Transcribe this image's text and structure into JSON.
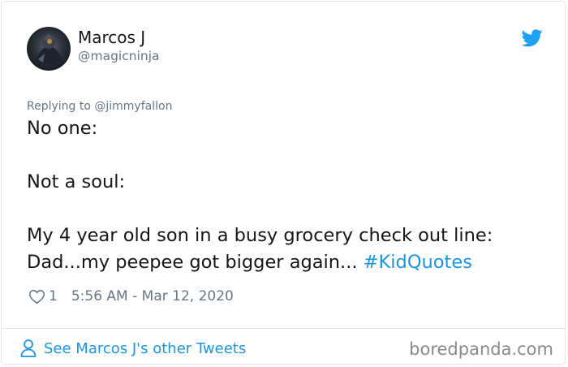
{
  "author": {
    "display_name": "Marcos J",
    "handle": "@magicninja",
    "avatar_icon": "avatar-photo"
  },
  "platform_icon": "twitter-bird-icon",
  "reply": {
    "label": "Replying to @jimmyfallon"
  },
  "tweet": {
    "lines": [
      "No one:",
      "",
      "Not a soul:",
      "",
      "My 4 year old son in a busy grocery check out line:"
    ],
    "last_line_text": "Dad...my peepee got bigger again... ",
    "hashtag": "#KidQuotes"
  },
  "meta": {
    "like_icon": "heart-icon",
    "like_count": "1",
    "timestamp": "5:56 AM - Mar 12, 2020"
  },
  "footer": {
    "link_icon": "person-icon",
    "link_label": "See Marcos J's other Tweets",
    "watermark": "boredpanda.com"
  },
  "colors": {
    "link": "#1b95e0",
    "text": "#14171a",
    "secondary": "#657786",
    "border": "#e1e8ed"
  }
}
